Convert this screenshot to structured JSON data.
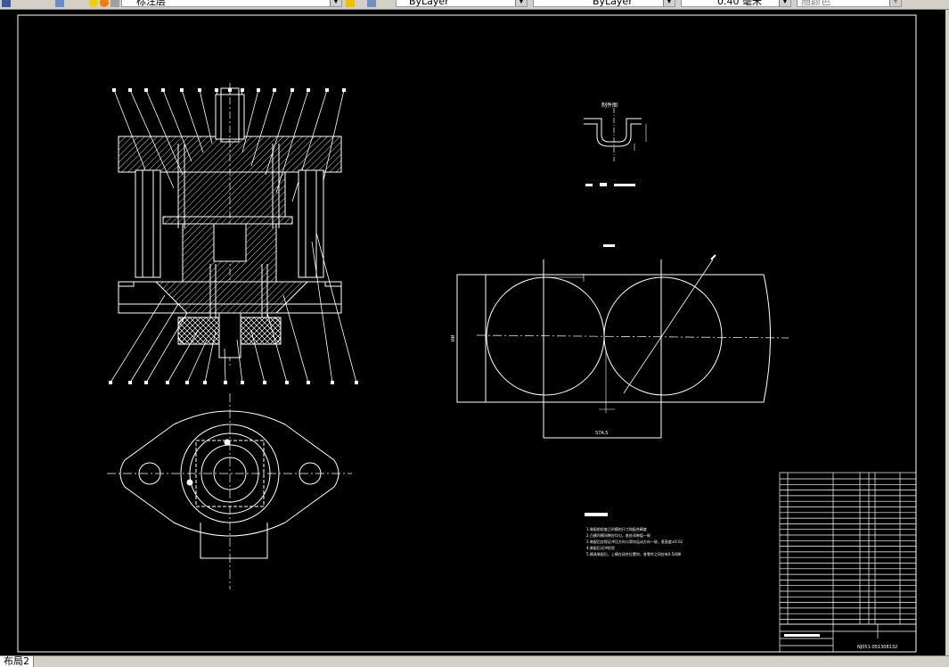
{
  "toolbar": {
    "layer_name": "标注层",
    "color": "ByLayer",
    "linetype": "ByLayer",
    "lineweight": "0.40 毫米",
    "plotstyle": "随颜色"
  },
  "drawing": {
    "part_view_title": "制件图",
    "dim_horizontal": "S7A.5",
    "dim_vertical": "ИИ",
    "drawing_number": "NJ051-051308132",
    "tech_requirements": [
      "1.装配前检查凸凹模的尺寸和配合精度",
      "2.凸模凹模间隙应均匀，各处间隙值一致",
      "3.装配后应保证冲压方向与滑块运动方向一致，垂直度±0.02",
      "4.装配后试冲检验",
      "5.模具装配后，上模在闭合位置时，各零件之间应有0.5间隙"
    ]
  },
  "layout_tab": "布局2"
}
